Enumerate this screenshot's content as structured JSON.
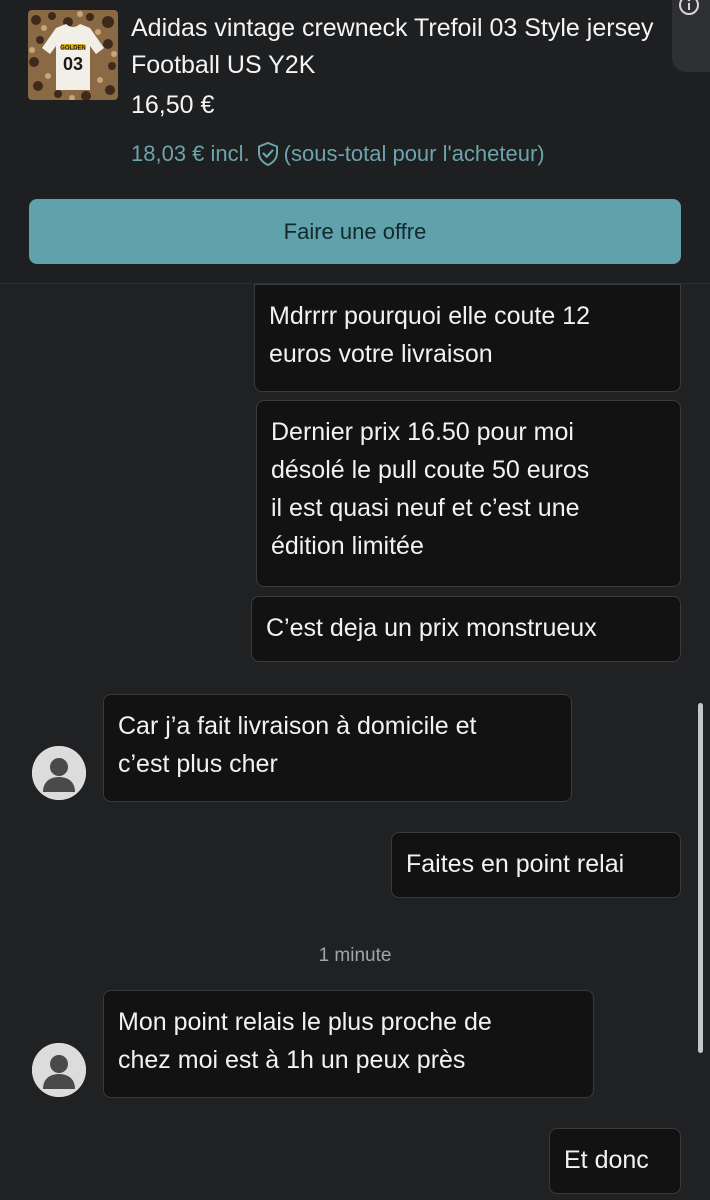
{
  "product": {
    "title": "Adidas vintage crewneck Trefoil 03 Style jersey Football US Y2K",
    "price": "16,50 €",
    "price_incl": "18,03 € incl.",
    "price_incl_note": "(sous-total pour l'acheteur)",
    "thumb_text_top": "GOLDEN",
    "thumb_text_number": "03",
    "accent_color": "#5fa2ac"
  },
  "actions": {
    "offer_label": "Faire une offre"
  },
  "chat": {
    "messages": [
      {
        "from": "me",
        "text": "Mdrrrr pourquoi elle coute 12\neuros votre livraison"
      },
      {
        "from": "me",
        "text": "Dernier prix 16.50 pour moi\ndésolé le pull coute 50 euros\nil est quasi neuf et c’est une\nédition limitée"
      },
      {
        "from": "me",
        "text": "C’est deja un prix monstrueux"
      },
      {
        "from": "other",
        "text": "Car j’a fait livraison à domicile et\nc’est plus cher"
      },
      {
        "from": "me",
        "text": "Faites en point relai"
      },
      {
        "from": "other",
        "text": "Mon point relais le plus proche de\nchez moi est à 1h un peux près"
      },
      {
        "from": "me",
        "text": "Et donc"
      }
    ],
    "timestamp": "1 minute"
  }
}
